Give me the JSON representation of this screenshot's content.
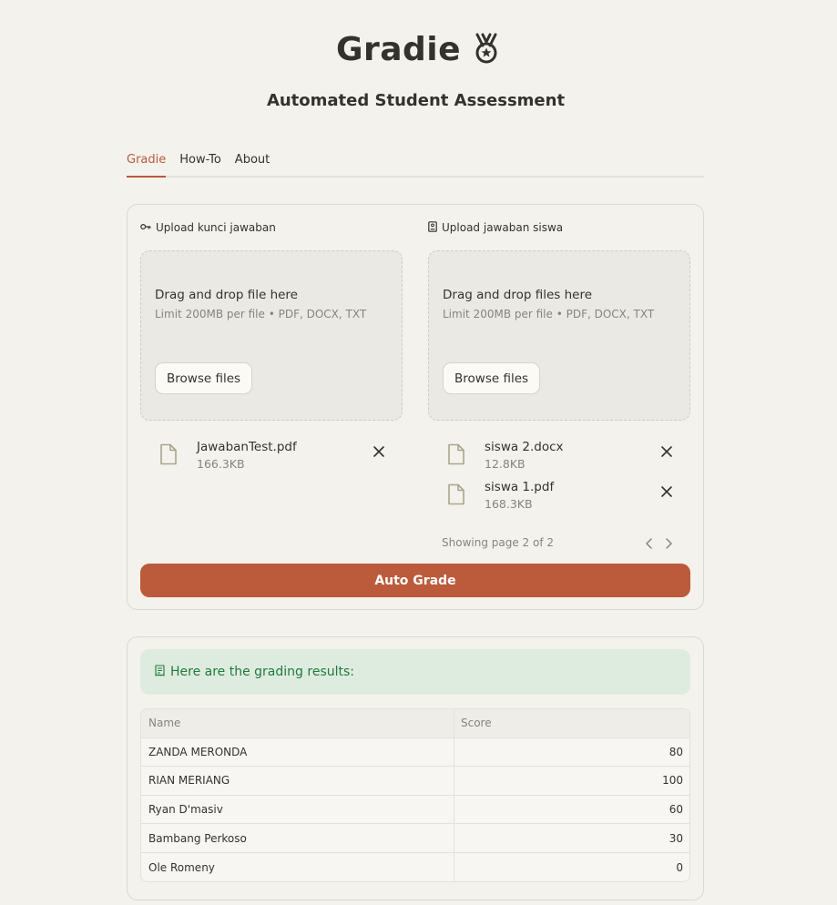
{
  "app": {
    "title": "Gradie",
    "title_icon": "medal-icon",
    "subtitle": "Automated Student Assessment"
  },
  "tabs": [
    {
      "label": "Gradie",
      "active": true
    },
    {
      "label": "How-To",
      "active": false
    },
    {
      "label": "About",
      "active": false
    }
  ],
  "upload_key": {
    "label": "Upload kunci jawaban",
    "icon": "key-icon",
    "dropzone_title": "Drag and drop file here",
    "dropzone_limit": "Limit 200MB per file • PDF, DOCX, TXT",
    "browse_label": "Browse files",
    "files": [
      {
        "name": "JawabanTest.pdf",
        "size": "166.3KB"
      }
    ]
  },
  "upload_student": {
    "label": "Upload jawaban siswa",
    "icon": "id-card-icon",
    "dropzone_title": "Drag and drop files here",
    "dropzone_limit": "Limit 200MB per file • PDF, DOCX, TXT",
    "browse_label": "Browse files",
    "files": [
      {
        "name": "siswa 2.docx",
        "size": "12.8KB"
      },
      {
        "name": "siswa 1.pdf",
        "size": "168.3KB"
      }
    ],
    "pagination": "Showing page 2 of 2"
  },
  "actions": {
    "auto_grade_label": "Auto Grade"
  },
  "results": {
    "message": "Here are the grading results:",
    "message_icon": "receipt-icon",
    "columns": [
      "Name",
      "Score"
    ],
    "rows": [
      {
        "name": "ZANDA MERONDA",
        "score": "80"
      },
      {
        "name": "RIAN MERIANG",
        "score": "100"
      },
      {
        "name": "Ryan D'masiv",
        "score": "60"
      },
      {
        "name": "Bambang Perkoso",
        "score": "30"
      },
      {
        "name": "Ole Romeny",
        "score": "0"
      }
    ]
  },
  "colors": {
    "background": "#f4f2ed",
    "accent": "#bb5b3b",
    "success_bg": "#deece0",
    "success_text": "#217a3a"
  }
}
